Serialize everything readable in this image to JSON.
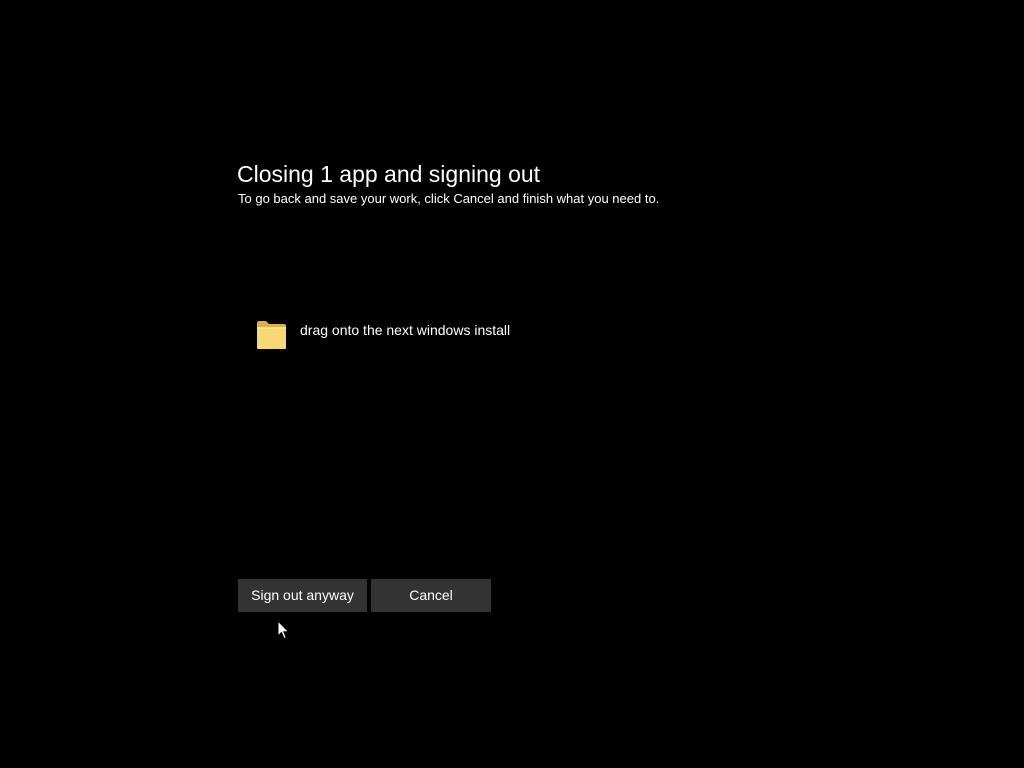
{
  "dialog": {
    "title": "Closing 1 app and signing out",
    "subtitle": "To go back and save your work, click Cancel and finish what you need to."
  },
  "apps": [
    {
      "label": "drag onto the next windows install",
      "icon": "folder-icon"
    }
  ],
  "buttons": {
    "sign_out_label": "Sign out anyway",
    "cancel_label": "Cancel"
  },
  "colors": {
    "background": "#000000",
    "text": "#ffffff",
    "button_bg": "#333333",
    "folder": "#f8d775"
  }
}
